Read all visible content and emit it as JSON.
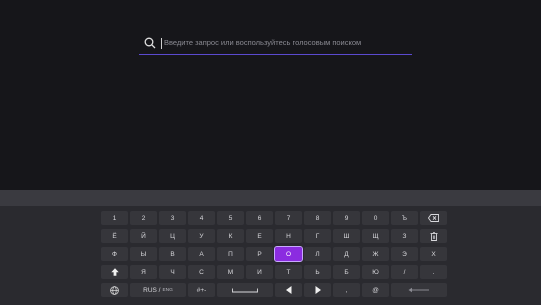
{
  "search": {
    "placeholder": "Введите запрос или воспользуйтесь голосовым поиском",
    "icon": "search-icon"
  },
  "keyboard": {
    "rows": [
      [
        "1",
        "2",
        "3",
        "4",
        "5",
        "6",
        "7",
        "8",
        "9",
        "0",
        "Ъ",
        "backspace"
      ],
      [
        "Ё",
        "Й",
        "Ц",
        "У",
        "К",
        "Е",
        "Н",
        "Г",
        "Ш",
        "Щ",
        "З",
        "trash"
      ],
      [
        "Ф",
        "Ы",
        "В",
        "А",
        "П",
        "Р",
        "О",
        "Л",
        "Д",
        "Ж",
        "Э",
        "Х"
      ],
      [
        "shift",
        "Я",
        "Ч",
        "С",
        "М",
        "И",
        "Т",
        "Ь",
        "Б",
        "Ю",
        "/",
        "."
      ],
      [
        "globe",
        "RUS / ENG",
        "#+-",
        "space",
        "left",
        "right",
        ",",
        "@",
        "enter"
      ]
    ],
    "selected_key": "О",
    "lang_primary": "RUS /",
    "lang_secondary": "ENG",
    "symbols_label": "#+-"
  },
  "colors": {
    "accent": "#8b2ce0",
    "search_underline": "#5b4ad0"
  }
}
